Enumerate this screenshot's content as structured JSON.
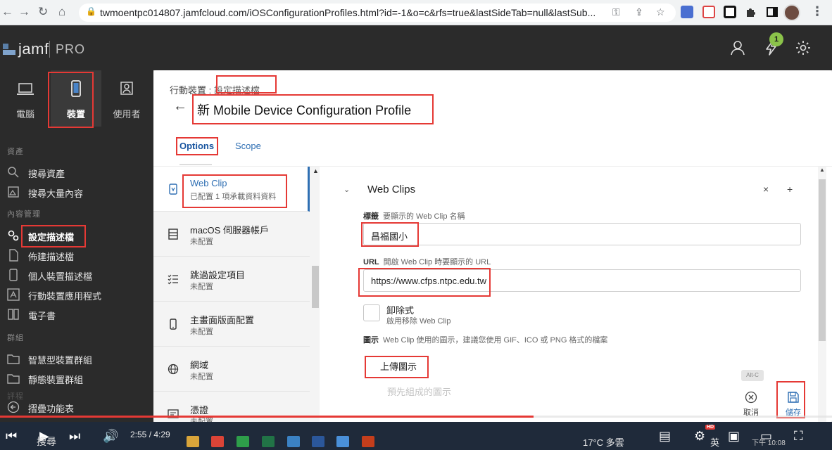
{
  "browser": {
    "url": "twmoentpc014807.jamfcloud.com/iOSConfigurationProfiles.html?id=-1&o=c&rfs=true&lastSideTab=null&lastSub..."
  },
  "app": {
    "logo_text": "jamf",
    "logo_suffix": "PRO",
    "notification_count": "1"
  },
  "sidebar": {
    "categories": [
      {
        "label": "電腦"
      },
      {
        "label": "裝置"
      },
      {
        "label": "使用者"
      }
    ],
    "section_inventory": "資產",
    "item_search_inventory": "搜尋資產",
    "item_search_volume": "搜尋大量內容",
    "section_content": "內容管理",
    "item_config_profiles": "設定描述檔",
    "item_provisioning": "佈建描述檔",
    "item_personal_profiles": "個人裝置描述檔",
    "item_mobile_apps": "行動裝置應用程式",
    "item_ebooks": "電子書",
    "section_groups": "群組",
    "item_smart_groups": "智慧型裝置群組",
    "item_static_groups": "靜態裝置群組",
    "section_faded": "評程",
    "collapse_label": "摺疊功能表"
  },
  "main": {
    "breadcrumb_prefix": "行動裝置 : ",
    "breadcrumb_link": "設定描述檔",
    "page_title": "新 Mobile Device Configuration Profile",
    "tabs": [
      {
        "label": "Options"
      },
      {
        "label": "Scope"
      }
    ],
    "payloads": [
      {
        "title": "Web Clip",
        "subtitle": "已配置 1 項承載資料資料"
      },
      {
        "title": "macOS 伺服器帳戶",
        "subtitle": "未配置"
      },
      {
        "title": "跳過設定項目",
        "subtitle": "未配置"
      },
      {
        "title": "主畫面版面配置",
        "subtitle": "未配置"
      },
      {
        "title": "網域",
        "subtitle": "未配置"
      },
      {
        "title": "憑證",
        "subtitle": "未配置"
      }
    ],
    "section_title": "Web Clips",
    "label_field": {
      "label": "標籤",
      "hint": "要顯示的 Web Clip 名稱",
      "value": "昌福國小"
    },
    "url_field": {
      "label": "URL",
      "hint": "開啟 Web Clip 時要顯示的 URL",
      "value": "https://www.cfps.ntpc.edu.tw"
    },
    "removable": {
      "title": "卸除式",
      "subtitle": "啟用移除 Web Clip"
    },
    "icon_field": {
      "label": "圖示",
      "hint": "Web Clip 使用的圖示，建議您使用 GIF、ICO 或 PNG 格式的檔案"
    },
    "upload_label": "上傳圖示",
    "faded_text": "預先組成的圖示",
    "shortcut_hint": "Alt-C",
    "cancel_label": "取消",
    "save_label": "儲存"
  },
  "video": {
    "time": "2:55 / 4:29",
    "progress_fraction": 0.641
  },
  "taskbar": {
    "search_label": "搜尋",
    "weather": "17°C 多雲",
    "lang": "英",
    "clock": "下午 10:08"
  },
  "colors": {
    "sidebar_bg": "#2b2b2b",
    "accent_blue": "#2f6fb3",
    "annotation_red": "#e53935",
    "badge_green": "#8bc34a"
  }
}
